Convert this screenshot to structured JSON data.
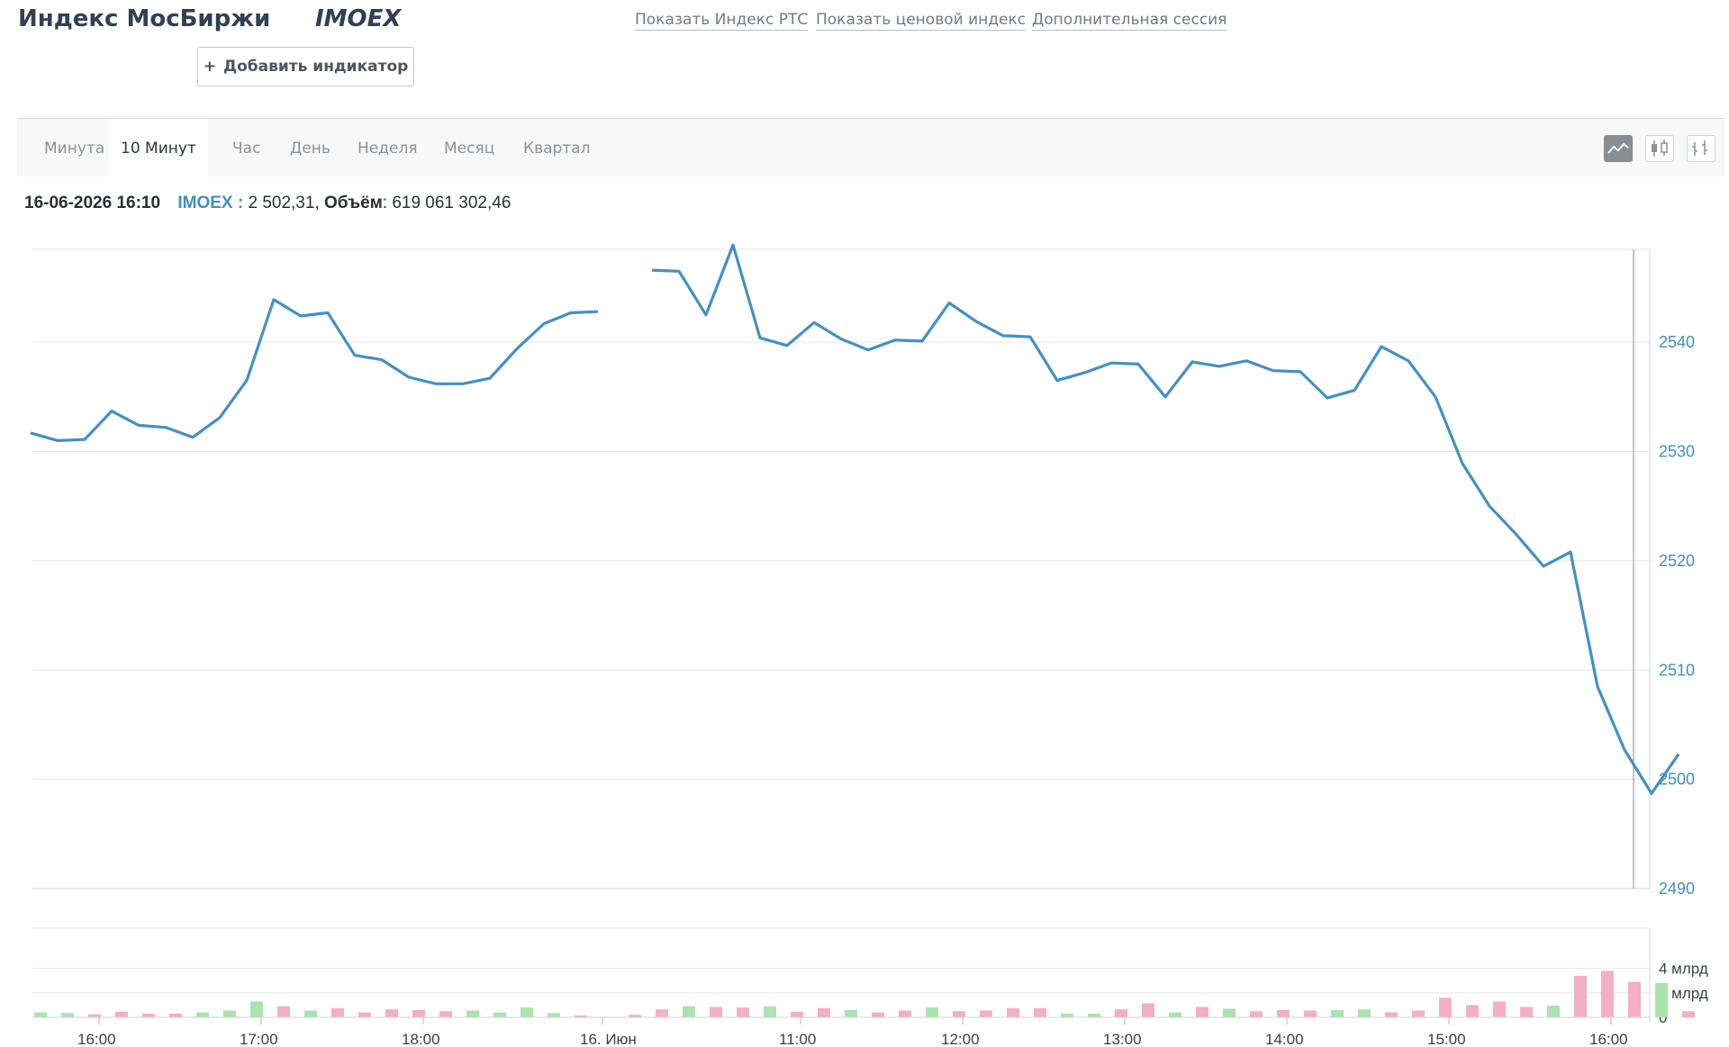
{
  "header": {
    "title": "Индекс МосБиржи",
    "ticker": "IMOEX",
    "links": [
      "Показать Индекс РТС",
      "Показать ценовой индекс",
      "Дополнительная сессия"
    ],
    "add_indicator": "Добавить индикатор",
    "add_icon": "plus-icon"
  },
  "toolbar": {
    "tabs": [
      "Минута",
      "10 Минут",
      "Час",
      "День",
      "Неделя",
      "Месяц",
      "Квартал"
    ],
    "active_tab": "10 Минут",
    "chart_types": [
      "line-chart-icon",
      "candlestick-chart-icon",
      "bar-chart-icon"
    ],
    "active_chart_type": "line-chart-icon"
  },
  "info": {
    "date": "16-06-2026 16:10",
    "symbol": "IMOEX :",
    "value": "2 502,31,",
    "volume_label": "Объём",
    "volume_value": ": 619 061 302,46"
  },
  "colors": {
    "line": "#4490c3",
    "vol_up": "#a9e3ad",
    "vol_down": "#f4aec6",
    "axis_text": "#3f8fc5"
  },
  "chart_data": {
    "type": "line",
    "x_labels": [
      "16:00",
      "17:00",
      "18:00",
      "16. Июн",
      "11:00",
      "12:00",
      "13:00",
      "14:00",
      "15:00",
      "16:00"
    ],
    "price": {
      "yticks": [
        2540,
        2530,
        2520,
        2510,
        2500,
        2490
      ],
      "ylim": [
        2490,
        2548.5
      ],
      "segments": [
        [
          2531.7,
          2531.0,
          2531.1,
          2533.7,
          2532.4,
          2532.2,
          2531.3,
          2533.1,
          2536.5,
          2543.9,
          2542.4,
          2542.7,
          2538.8,
          2538.4,
          2536.8,
          2536.2,
          2536.2,
          2536.7,
          2539.4,
          2541.7,
          2542.7,
          2542.8
        ],
        [
          2546.6,
          2546.5,
          2542.5,
          2548.9,
          2540.4,
          2539.7,
          2541.8,
          2540.3,
          2539.3,
          2540.2,
          2540.1,
          2543.6,
          2541.9,
          2540.6,
          2540.5,
          2536.5,
          2537.2,
          2538.1,
          2538.0,
          2535.0,
          2538.2,
          2537.8,
          2538.3,
          2537.4,
          2537.3,
          2534.9,
          2535.6,
          2539.6,
          2538.3,
          2535.0,
          2528.9,
          2525.0,
          2522.4,
          2519.5,
          2520.8,
          2508.5,
          2502.7,
          2498.7,
          2502.3
        ]
      ]
    },
    "volume": {
      "yticks": [
        "4 млрд",
        "2 млрд",
        "0"
      ],
      "ymax_mlrd": 7.0,
      "bars": [
        {
          "v": 0.4,
          "up": true
        },
        {
          "v": 0.35,
          "up": true
        },
        {
          "v": 0.25,
          "up": false
        },
        {
          "v": 0.45,
          "up": false
        },
        {
          "v": 0.3,
          "up": false
        },
        {
          "v": 0.3,
          "up": false
        },
        {
          "v": 0.4,
          "up": true
        },
        {
          "v": 0.55,
          "up": true
        },
        {
          "v": 1.3,
          "up": true
        },
        {
          "v": 0.9,
          "up": false
        },
        {
          "v": 0.55,
          "up": true
        },
        {
          "v": 0.75,
          "up": false
        },
        {
          "v": 0.4,
          "up": false
        },
        {
          "v": 0.65,
          "up": false
        },
        {
          "v": 0.6,
          "up": false
        },
        {
          "v": 0.5,
          "up": false
        },
        {
          "v": 0.55,
          "up": true
        },
        {
          "v": 0.4,
          "up": true
        },
        {
          "v": 0.8,
          "up": true
        },
        {
          "v": 0.35,
          "up": true
        },
        {
          "v": 0.15,
          "up": false
        },
        {
          "v": 0.2,
          "up": false
        },
        {
          "v": 0.65,
          "up": false
        },
        {
          "v": 0.9,
          "up": true
        },
        {
          "v": 0.85,
          "up": false
        },
        {
          "v": 0.8,
          "up": false
        },
        {
          "v": 0.9,
          "up": true
        },
        {
          "v": 0.45,
          "up": false
        },
        {
          "v": 0.75,
          "up": false
        },
        {
          "v": 0.6,
          "up": true
        },
        {
          "v": 0.4,
          "up": false
        },
        {
          "v": 0.55,
          "up": false
        },
        {
          "v": 0.8,
          "up": true
        },
        {
          "v": 0.5,
          "up": false
        },
        {
          "v": 0.55,
          "up": false
        },
        {
          "v": 0.75,
          "up": false
        },
        {
          "v": 0.75,
          "up": false
        },
        {
          "v": 0.3,
          "up": true
        },
        {
          "v": 0.3,
          "up": true
        },
        {
          "v": 0.65,
          "up": false
        },
        {
          "v": 1.15,
          "up": false
        },
        {
          "v": 0.4,
          "up": true
        },
        {
          "v": 0.85,
          "up": false
        },
        {
          "v": 0.7,
          "up": true
        },
        {
          "v": 0.5,
          "up": false
        },
        {
          "v": 0.6,
          "up": false
        },
        {
          "v": 0.55,
          "up": false
        },
        {
          "v": 0.6,
          "up": true
        },
        {
          "v": 0.65,
          "up": true
        },
        {
          "v": 0.4,
          "up": false
        },
        {
          "v": 0.55,
          "up": false
        },
        {
          "v": 1.6,
          "up": false
        },
        {
          "v": 1.0,
          "up": false
        },
        {
          "v": 1.3,
          "up": false
        },
        {
          "v": 0.85,
          "up": false
        },
        {
          "v": 0.95,
          "up": true
        },
        {
          "v": 3.4,
          "up": false
        },
        {
          "v": 3.8,
          "up": false
        },
        {
          "v": 2.9,
          "up": false
        },
        {
          "v": 2.8,
          "up": true
        },
        {
          "v": 0.5,
          "up": false
        }
      ]
    }
  }
}
